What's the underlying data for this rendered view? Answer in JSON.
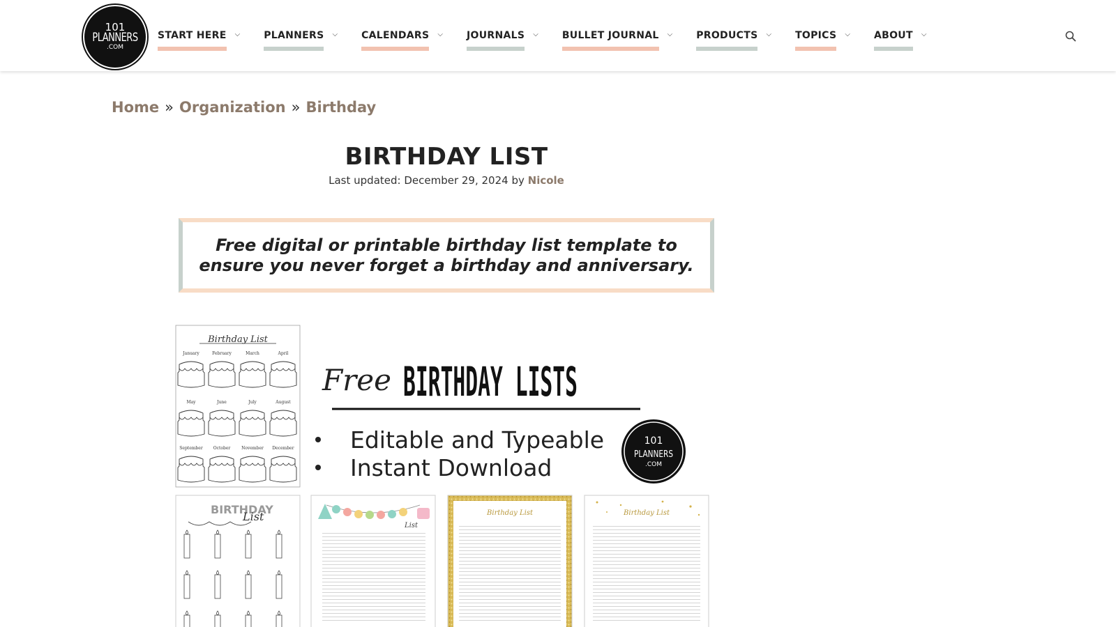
{
  "logo": {
    "line1": "101",
    "line2": "PLANNERS",
    "line3": ".COM"
  },
  "nav": [
    {
      "label": "START HERE",
      "variant": "pink"
    },
    {
      "label": "PLANNERS",
      "variant": "grey"
    },
    {
      "label": "CALENDARS",
      "variant": "pink"
    },
    {
      "label": "JOURNALS",
      "variant": "grey"
    },
    {
      "label": "BULLET JOURNAL",
      "variant": "pink"
    },
    {
      "label": "PRODUCTS",
      "variant": "grey"
    },
    {
      "label": "TOPICS",
      "variant": "pink"
    },
    {
      "label": "ABOUT",
      "variant": "grey"
    }
  ],
  "breadcrumb": {
    "home": "Home",
    "section": "Organization",
    "current": "Birthday",
    "separator": "»"
  },
  "article": {
    "title": "BIRTHDAY LIST",
    "updated_prefix": "Last updated: December 29, 2024 by",
    "author": "Nicole",
    "callout": "Free digital or printable birthday list template to ensure you never forget a birthday and anniversary."
  },
  "hero": {
    "free": "Free",
    "headline": "BIRTHDAY LISTS",
    "bullet1": "Editable and Typeable",
    "bullet2": "Instant Download",
    "card1_title": "Birthday List",
    "months_row1": [
      "January",
      "February",
      "March",
      "April"
    ],
    "months_row2": [
      "May",
      "June",
      "July",
      "August"
    ],
    "months_row3": [
      "September",
      "October",
      "November",
      "December"
    ],
    "card2_title": "BIRTHDAY",
    "card2_script": "List",
    "card3_title": "List",
    "card4_title": "Birthday List",
    "card5_title": "Birthday List"
  },
  "colors": {
    "accent_pink": "#f2c2b0",
    "accent_grey": "#c7d1cc",
    "link": "#8c7a6b",
    "gold": "#d4b24a"
  }
}
